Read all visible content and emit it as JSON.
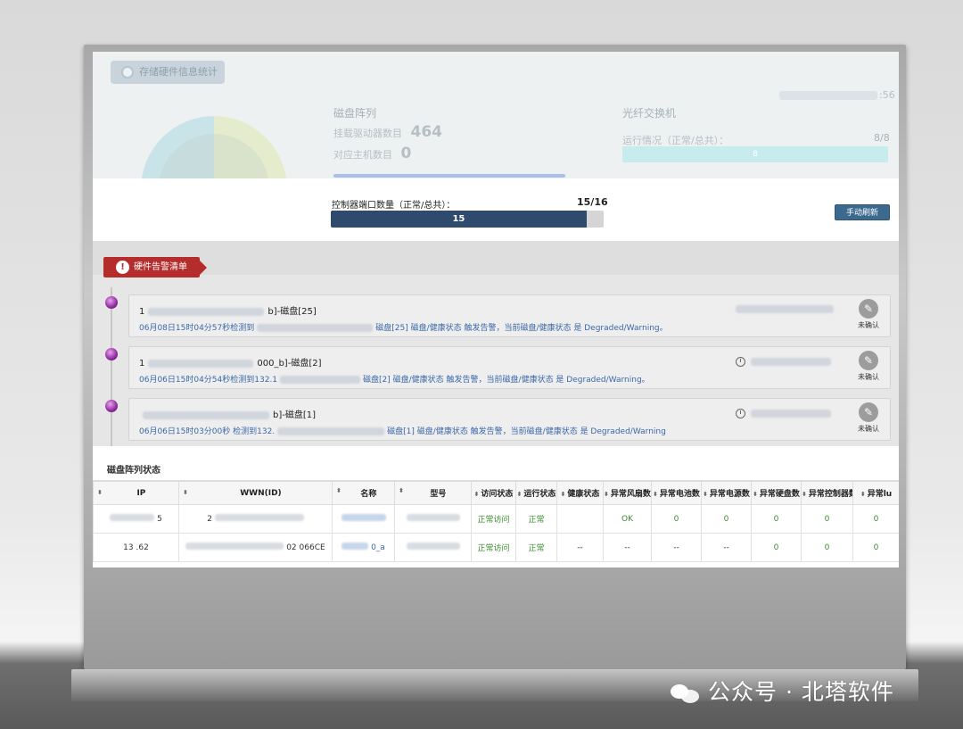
{
  "top_panel": {
    "tag_label": "存储硬件信息统计",
    "disk_array_title": "磁盘阵列",
    "driver_count_label": "挂载驱动器数目",
    "driver_count": "464",
    "host_count_label": "对应主机数目",
    "host_count": "0",
    "fc_switch_title": "光纤交换机",
    "fc_run_label": "运行情况（正常/总共）：",
    "fc_run_ratio": "8/8",
    "fc_bar_value": "8",
    "top_right_value": ":56"
  },
  "controller_port": {
    "label": "控制器端口数量（正常/总共）：",
    "ratio": "15/16",
    "bar_value": "15",
    "normal": 15,
    "total": 16
  },
  "refresh_button": "手动刷新",
  "alarm_list": {
    "title": "硬件告警清单",
    "items": [
      {
        "title_prefix": "1",
        "title_suffix": "b]-磁盘[25]",
        "desc_prefix": "06月08日15时04分57秒检测到",
        "desc_suffix": "磁盘[25] 磁盘/健康状态 触发告警，当前磁盘/健康状态 是 Degraded/Warning。",
        "confirm": "未确认"
      },
      {
        "title_prefix": "1",
        "title_suffix": "000_b]-磁盘[2]",
        "desc_prefix": "06月06日15时04分54秒检测到132.1",
        "desc_suffix": "磁盘[2] 磁盘/健康状态 触发告警，当前磁盘/健康状态 是 Degraded/Warning。",
        "confirm": "未确认"
      },
      {
        "title_prefix": "",
        "title_suffix": "b]-磁盘[1]",
        "desc_prefix": "06月06日15时03分00秒 检测到132.",
        "desc_suffix": "磁盘[1] 磁盘/健康状态 触发告警，当前磁盘/健康状态 是 Degraded/Warning",
        "confirm": "未确认"
      }
    ]
  },
  "array_status": {
    "title": "磁盘阵列状态",
    "columns": [
      "IP",
      "WWN(ID)",
      "名称",
      "型号",
      "访问状态",
      "运行状态",
      "健康状态",
      "异常风扇数",
      "异常电池数",
      "异常电源数",
      "异常硬盘数",
      "异常控制器数",
      "异常lu"
    ],
    "rows": [
      {
        "ip": "5",
        "wwn": "2",
        "name_link": "",
        "model": "",
        "access": "正常访问",
        "run": "正常",
        "health": "",
        "fan": "OK",
        "battery": "0",
        "power": "0",
        "disk": "0",
        "controller": "0",
        "lu": "0"
      },
      {
        "ip": "13 .62",
        "wwn": "02 066CE",
        "name_link": "0_a",
        "model": "",
        "access": "正常访问",
        "run": "正常",
        "health": "--",
        "fan": "--",
        "battery": "--",
        "power": "--",
        "disk": "0",
        "controller": "0",
        "lu": "0"
      }
    ]
  },
  "watermark": "公众号 · 北塔软件",
  "colors": {
    "alarm_red": "#b52c2c",
    "progress_navy": "#2e4a6d",
    "refresh_button": "#3c6a8f",
    "ok_green": "#3b8a2e",
    "link_blue": "#3a68a8"
  }
}
